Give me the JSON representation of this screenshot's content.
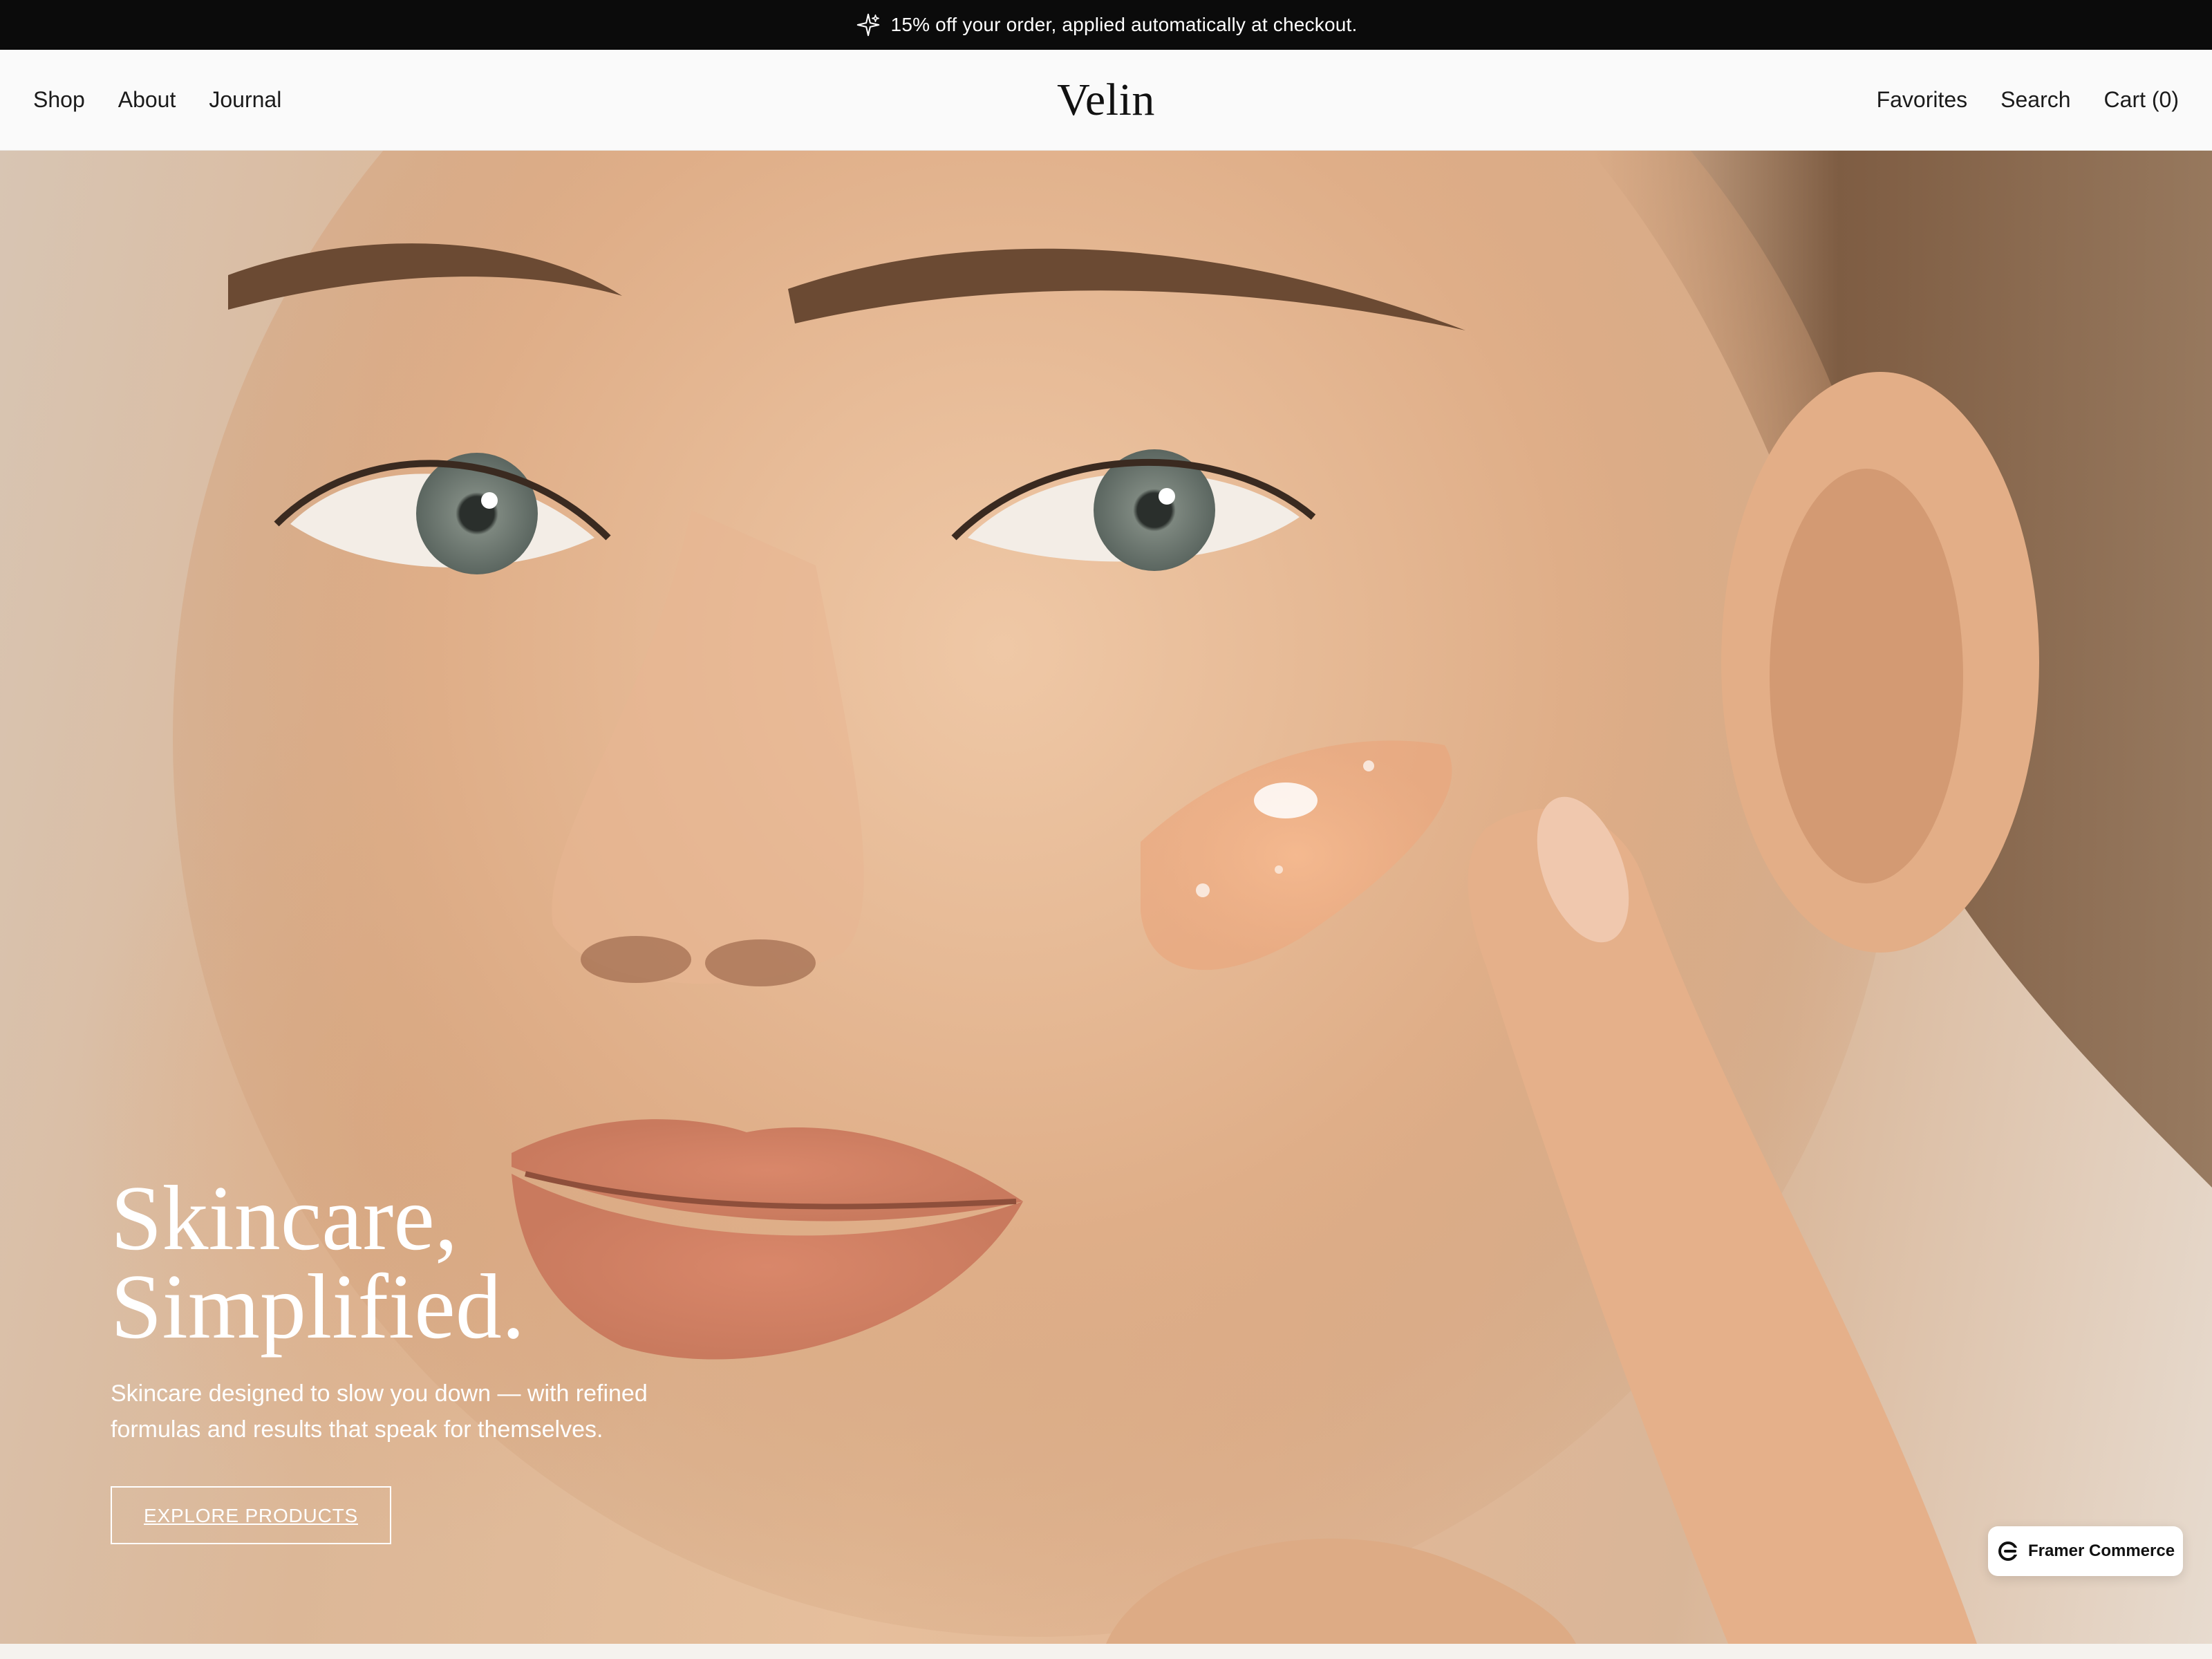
{
  "announcement": {
    "text": "15% off your order, applied automatically at checkout.",
    "icon": "sparkle-icon"
  },
  "header": {
    "brand": "Velin",
    "nav_left": [
      "Shop",
      "About",
      "Journal"
    ],
    "nav_right": [
      "Favorites",
      "Search",
      "Cart (0)"
    ]
  },
  "hero": {
    "headline_line1": "Skincare,",
    "headline_line2": "Simplified.",
    "subtitle": "Skincare designed to slow you down — with refined formulas and results that speak for themselves.",
    "cta_label": "EXPLORE PRODUCTS"
  },
  "badge": {
    "label": "Framer Commerce",
    "icon": "framer-commerce-icon"
  },
  "colors": {
    "announcement_bg": "#0b0b0b",
    "header_bg": "#fafafa",
    "hero_text": "#ffffff"
  }
}
